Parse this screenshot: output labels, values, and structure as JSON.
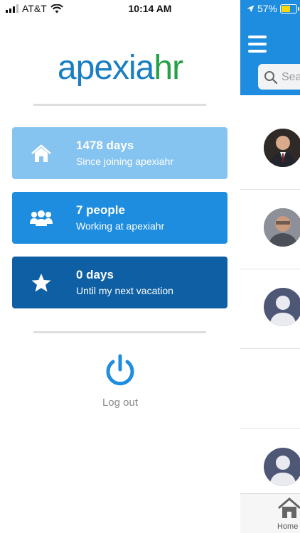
{
  "status_bar": {
    "carrier": "AT&T",
    "time": "10:14 AM",
    "battery": "57%"
  },
  "drawer": {
    "logo": {
      "part1": "apexia",
      "part2": "hr",
      "color1": "#1a7fc2",
      "color2": "#25a048"
    },
    "cards": [
      {
        "title": "1478 days",
        "subtitle": "Since joining apexiahr",
        "icon": "home-icon",
        "color": "#85c3f0"
      },
      {
        "title": "7 people",
        "subtitle": "Working at apexiahr",
        "icon": "people-icon",
        "color": "#1e8ddf"
      },
      {
        "title": "0 days",
        "subtitle": "Until my next vacation",
        "icon": "star-icon",
        "color": "#0e5fa3"
      }
    ],
    "logout_label": "Log out"
  },
  "main": {
    "header_color": "#1e8ddf",
    "search_placeholder": "Sea",
    "tab_home_label": "Home"
  }
}
